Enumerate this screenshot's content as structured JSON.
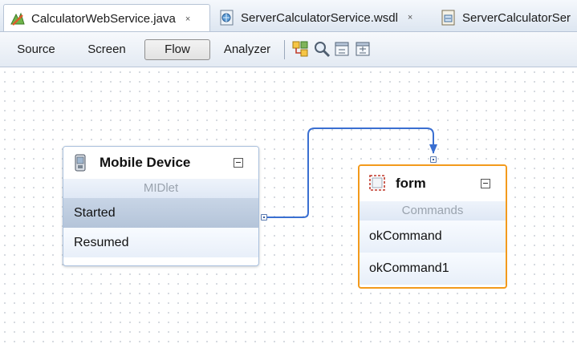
{
  "tabs": [
    {
      "label": "CalculatorWebService.java",
      "close": "×",
      "icon": "java-bean-icon",
      "active": true
    },
    {
      "label": "ServerCalculatorService.wsdl",
      "close": "×",
      "icon": "wsdl-file-icon",
      "active": false
    },
    {
      "label": "ServerCalculatorSer",
      "icon": "wsdl-file-icon",
      "active": false
    }
  ],
  "toolbar": {
    "source": "Source",
    "screen": "Screen",
    "flow": "Flow",
    "analyzer": "Analyzer",
    "icons": [
      "layout-icon",
      "zoom-icon",
      "collapse-all-icon",
      "expand-all-icon"
    ]
  },
  "flow": {
    "device": {
      "title": "Mobile Device",
      "subtitle": "MIDlet",
      "items": [
        "Started",
        "Resumed"
      ],
      "selected": "Started"
    },
    "form": {
      "title": "form",
      "subtitle": "Commands",
      "items": [
        "okCommand",
        "okCommand1"
      ]
    },
    "colors": {
      "connector": "#3a6fd1",
      "selection_border": "#f39a1c",
      "node_border": "#a9c0dd"
    }
  }
}
